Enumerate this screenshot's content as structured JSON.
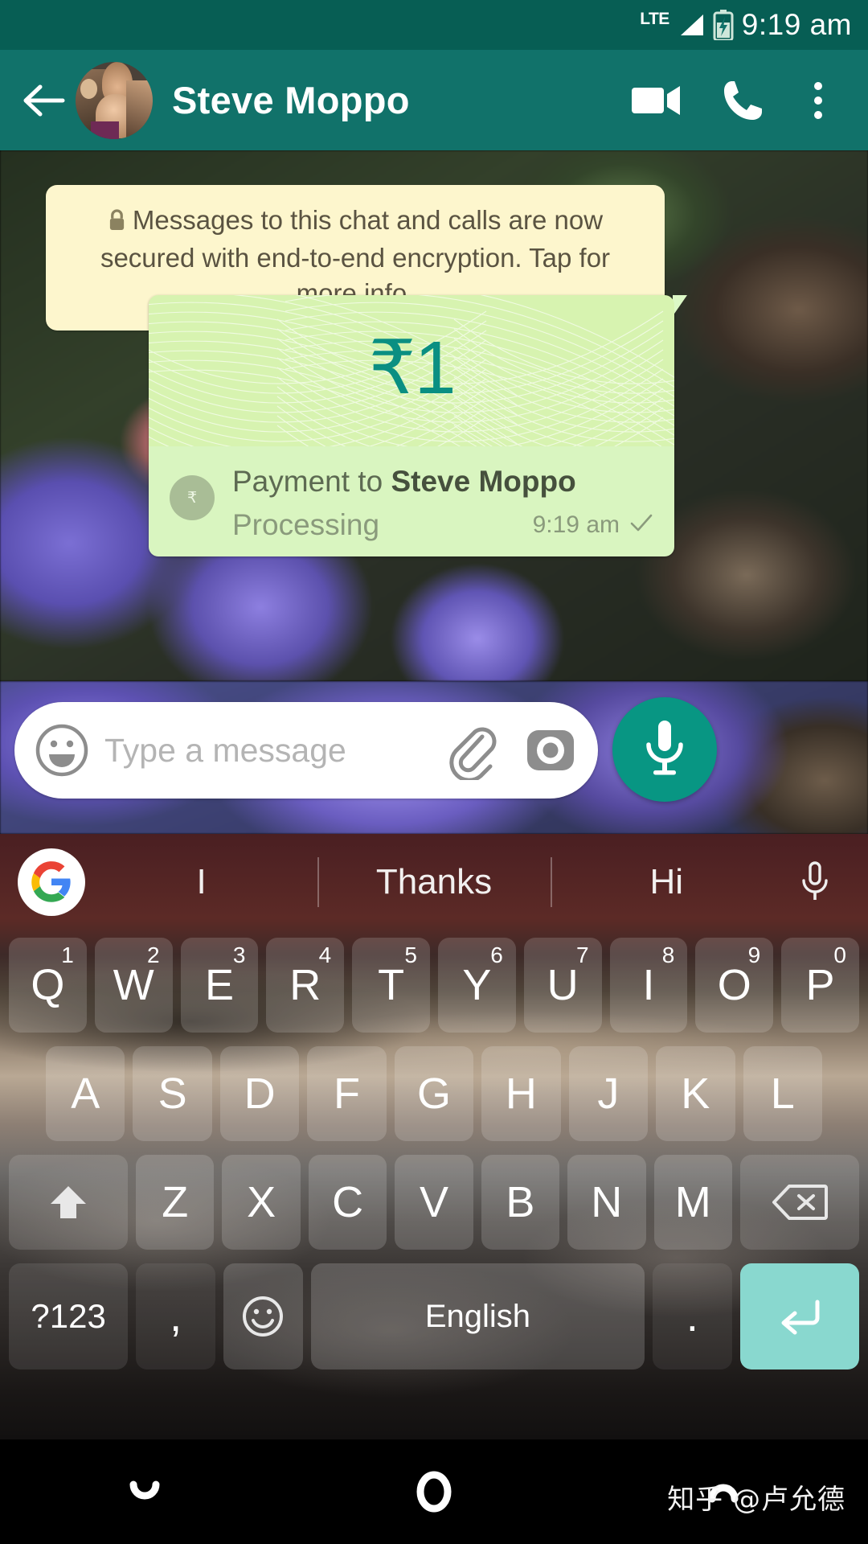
{
  "statusbar": {
    "network": "LTE",
    "time": "9:19 am",
    "signal_icon": "signal-bars-icon",
    "battery_icon": "battery-charging-icon"
  },
  "appbar": {
    "back_icon": "back-arrow-icon",
    "avatar_name": "contact-avatar",
    "title": "Steve Moppo",
    "video_call_icon": "video-call-icon",
    "voice_call_icon": "phone-call-icon",
    "overflow_icon": "more-vert-icon"
  },
  "encryption_notice": {
    "lock_icon": "lock-icon",
    "text": "Messages to this chat and calls are now secured with end-to-end encryption. Tap for more info."
  },
  "payment_message": {
    "currency_symbol": "₹",
    "amount": "1",
    "amount_display": "₹1",
    "badge_icon": "rupee-badge-icon",
    "title_prefix": "Payment to ",
    "recipient": "Steve Moppo",
    "status": "Processing",
    "time": "9:19 am",
    "delivery_icon": "single-check-icon",
    "accent_color": "#0a8f82",
    "bubble_color": "#d9f5c0"
  },
  "input_bar": {
    "emoji_icon": "emoji-smiley-icon",
    "placeholder": "Type a message",
    "value": "",
    "attach_icon": "paperclip-icon",
    "camera_icon": "camera-icon",
    "mic_icon": "microphone-icon",
    "mic_color": "#089683"
  },
  "keyboard": {
    "google_logo": "google-g-logo-icon",
    "suggestions": [
      "I",
      "Thanks",
      "Hi"
    ],
    "voice_icon": "microphone-icon",
    "row1": [
      {
        "letter": "Q",
        "number": "1"
      },
      {
        "letter": "W",
        "number": "2"
      },
      {
        "letter": "E",
        "number": "3"
      },
      {
        "letter": "R",
        "number": "4"
      },
      {
        "letter": "T",
        "number": "5"
      },
      {
        "letter": "Y",
        "number": "6"
      },
      {
        "letter": "U",
        "number": "7"
      },
      {
        "letter": "I",
        "number": "8"
      },
      {
        "letter": "O",
        "number": "9"
      },
      {
        "letter": "P",
        "number": "0"
      }
    ],
    "row2": [
      "A",
      "S",
      "D",
      "F",
      "G",
      "H",
      "J",
      "K",
      "L"
    ],
    "row3": {
      "shift_icon": "shift-up-icon",
      "letters": [
        "Z",
        "X",
        "C",
        "V",
        "B",
        "N",
        "M"
      ],
      "backspace_icon": "backspace-icon"
    },
    "row4": {
      "symbols_label": "?123",
      "comma_label": ",",
      "emoji_icon": "emoji-smiley-icon",
      "space_label": "English",
      "period_label": ".",
      "enter_icon": "enter-return-icon",
      "enter_color": "#89d8cf"
    }
  },
  "navbar": {
    "back_icon": "nav-back-icon",
    "home_icon": "nav-home-icon",
    "recents_icon": "nav-recents-icon"
  },
  "watermark": {
    "text": "知乎 @卢允德"
  }
}
